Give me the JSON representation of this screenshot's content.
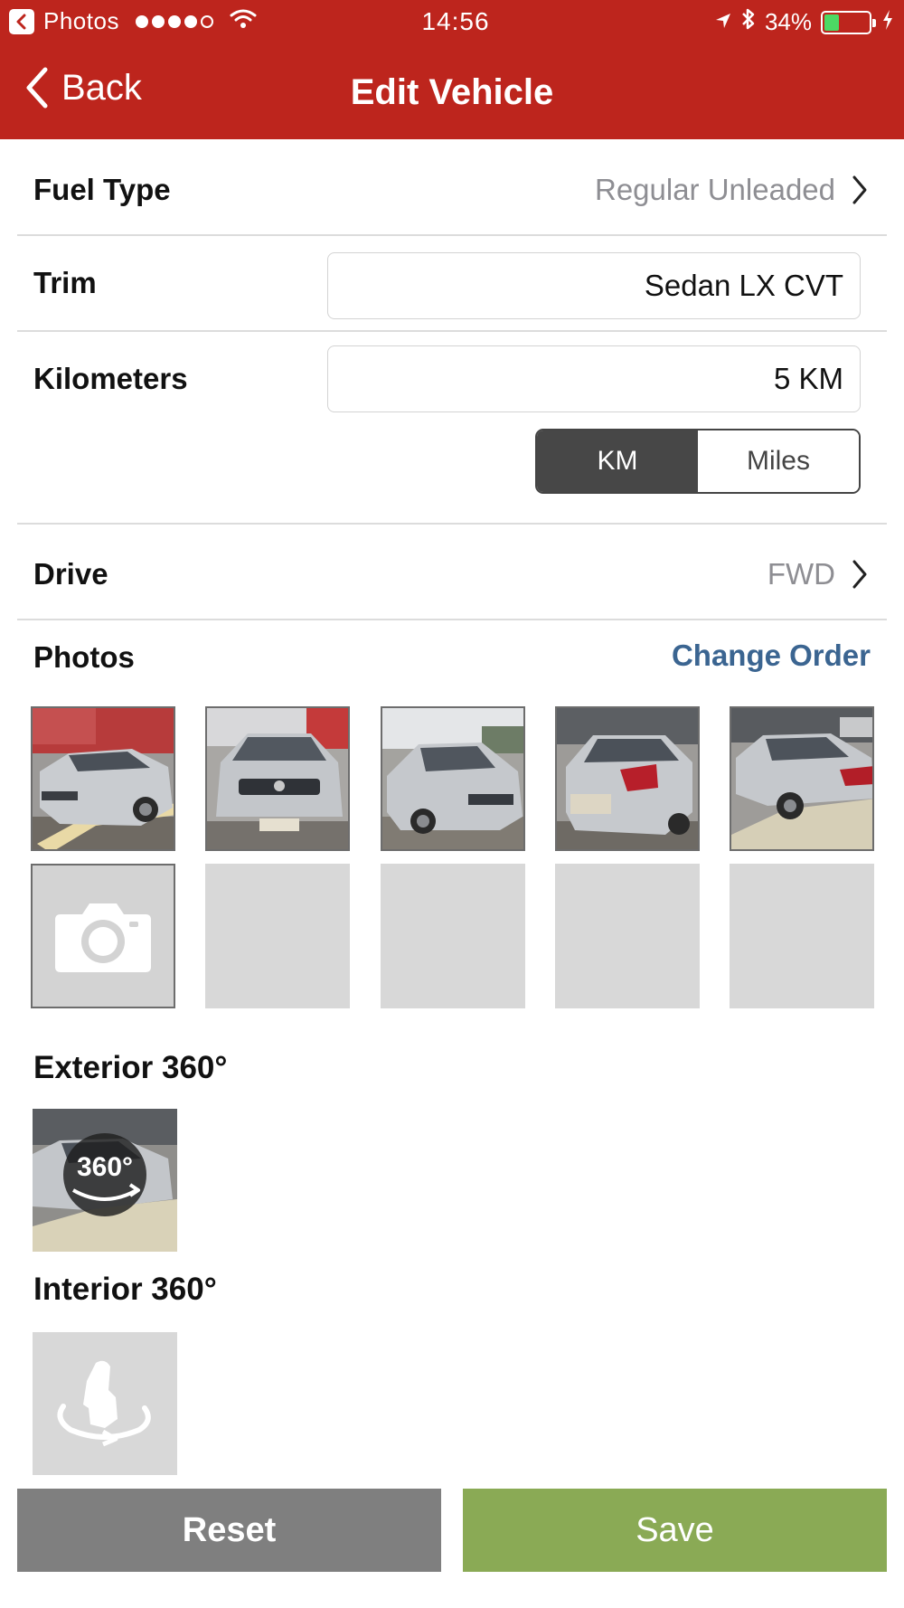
{
  "status_bar": {
    "app_name": "Photos",
    "time": "14:56",
    "battery_percent": "34%",
    "battery_level": 0.34,
    "signal_bars_filled": 4,
    "signal_bars_total": 5
  },
  "nav": {
    "back_label": "Back",
    "title": "Edit Vehicle"
  },
  "fields": {
    "fuel_type": {
      "label": "Fuel Type",
      "value": "Regular Unleaded"
    },
    "trim": {
      "label": "Trim",
      "value": "Sedan LX CVT"
    },
    "kilometers": {
      "label": "Kilometers",
      "value": "5 KM"
    },
    "unit_toggle": {
      "options": [
        "KM",
        "Miles"
      ],
      "selected": "KM"
    },
    "drive": {
      "label": "Drive",
      "value": "FWD"
    }
  },
  "photos": {
    "title": "Photos",
    "change_order_label": "Change Order",
    "photo_count": 5,
    "empty_slots": 4
  },
  "exterior_360": {
    "title": "Exterior 360°",
    "badge": "360°"
  },
  "interior_360": {
    "title": "Interior 360°"
  },
  "buttons": {
    "reset_label": "Reset",
    "save_label": "Save"
  },
  "colors": {
    "header_red": "#bd251d",
    "link_blue": "#3b6591",
    "save_green": "#8aaa55",
    "reset_gray": "#7f7f7f",
    "segment_active": "#474747"
  }
}
